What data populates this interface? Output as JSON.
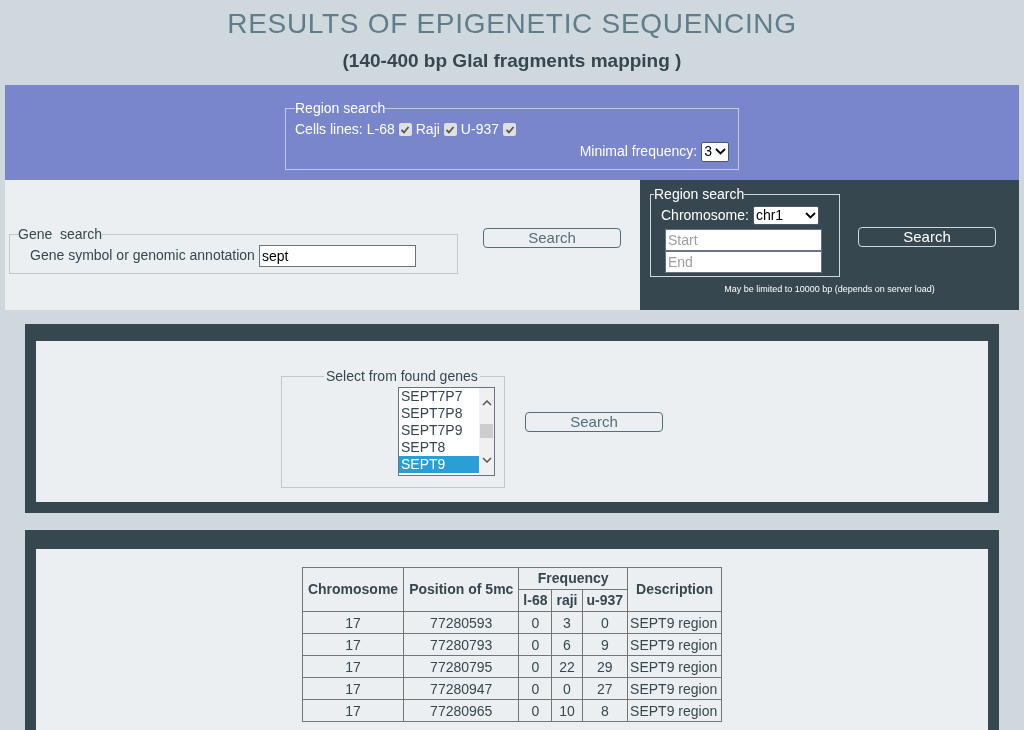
{
  "title": "RESULTS OF EPIGENETIC SEQUENCING",
  "subtitle": "(140-400 bp GlaI fragments mapping )",
  "cell_filter": {
    "legend": "Region search",
    "label": "Cells lines:",
    "cells": [
      {
        "label": "L-68",
        "checked": true
      },
      {
        "label": "Raji",
        "checked": true
      },
      {
        "label": "U-937",
        "checked": true
      }
    ],
    "frequency_label": "Minimal frequency:",
    "frequency_value": "3"
  },
  "gene_search": {
    "legend": "Gene  search",
    "label": "Gene symbol or genomic annotation",
    "value": "sept",
    "button": "Search"
  },
  "region_search": {
    "legend": "Region search",
    "chromosome_label": "Chromosome:",
    "chromosome_value": "chr1",
    "start_placeholder": "Start",
    "end_placeholder": "End",
    "button": "Search",
    "note": "May be limited to 10000 bp (depends on server load)"
  },
  "gene_select": {
    "legend": "Select from found genes",
    "options": [
      {
        "label": "SEPT7P7",
        "selected": false
      },
      {
        "label": "SEPT7P8",
        "selected": false
      },
      {
        "label": "SEPT7P9",
        "selected": false
      },
      {
        "label": "SEPT8",
        "selected": false
      },
      {
        "label": "SEPT9",
        "selected": true
      }
    ],
    "button": "Search"
  },
  "table": {
    "columns": [
      "Chromosome",
      "Position of 5mc"
    ],
    "group_column": "Frequency",
    "sub_columns": [
      "l-68",
      "raji",
      "u-937"
    ],
    "last_column": "Description",
    "rows": [
      [
        "17",
        "77280593",
        "0",
        "3",
        "0",
        "SEPT9 region"
      ],
      [
        "17",
        "77280793",
        "0",
        "6",
        "9",
        "SEPT9 region"
      ],
      [
        "17",
        "77280795",
        "0",
        "22",
        "29",
        "SEPT9 region"
      ],
      [
        "17",
        "77280947",
        "0",
        "0",
        "27",
        "SEPT9 region"
      ],
      [
        "17",
        "77280965",
        "0",
        "10",
        "8",
        "SEPT9 region"
      ]
    ]
  }
}
